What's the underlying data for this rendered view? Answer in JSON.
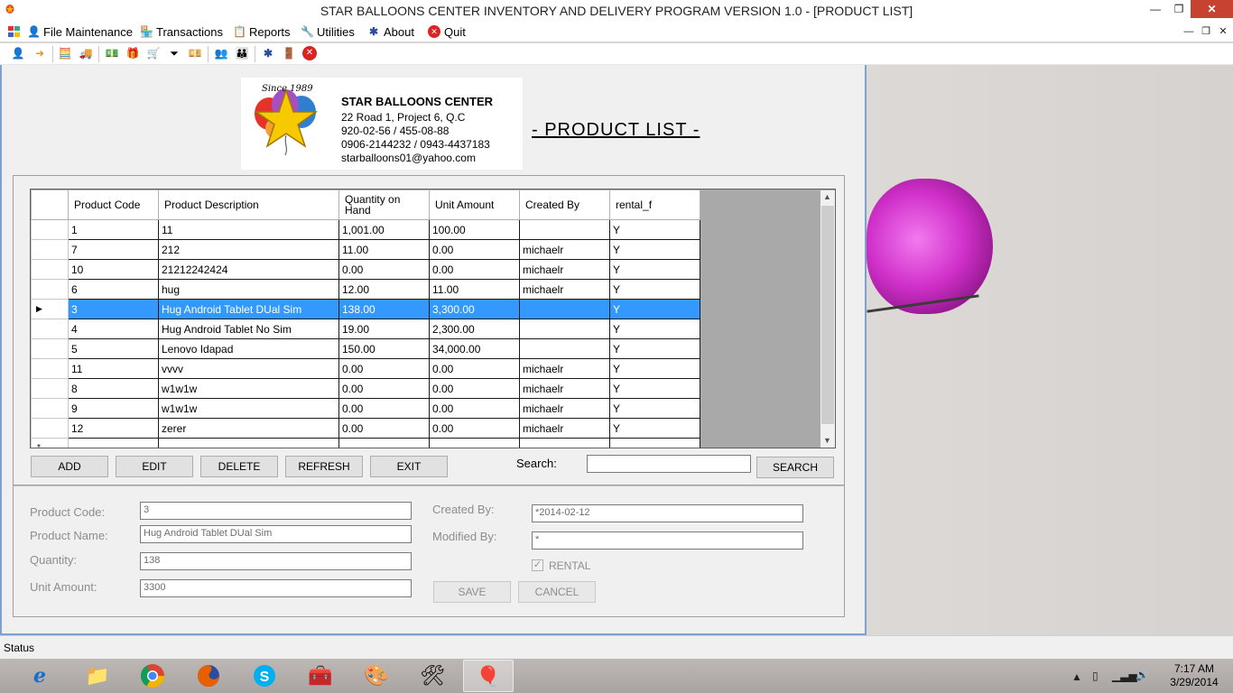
{
  "window": {
    "title": "STAR BALLOONS CENTER INVENTORY AND DELIVERY PROGRAM VERSION 1.0 - [PRODUCT LIST]",
    "app_icon": "balloon-icon",
    "minimize": "—",
    "maximize": "❐",
    "close": "✕"
  },
  "menu": {
    "items": [
      {
        "label": "File Maintenance",
        "icon": "person-icon"
      },
      {
        "label": "Transactions",
        "icon": "store-icon"
      },
      {
        "label": "Reports",
        "icon": "report-icon"
      },
      {
        "label": "Utilities",
        "icon": "wrench-icon"
      },
      {
        "label": "About",
        "icon": "about-icon"
      },
      {
        "label": "Quit",
        "icon": "quit-icon"
      }
    ],
    "mdi_min": "—",
    "mdi_restore": "❐",
    "mdi_close": "✕"
  },
  "toolbar": {
    "icons": [
      "user-icon",
      "arrow-icon",
      "calculator-icon",
      "truck-icon",
      "money-icon",
      "gift-icon",
      "filter-icon",
      "cart-icon",
      "cash-icon",
      "people-icon",
      "group-icon",
      "info-icon",
      "exit-door-icon",
      "close-circle-icon"
    ]
  },
  "logo": {
    "since": "Since 1989",
    "company": "STAR BALLOONS CENTER",
    "address_lines": [
      "22 Road 1, Project 6, Q.C",
      "920-02-56 / 455-08-88",
      "0906-2144232 / 0943-4437183",
      "starballoons01@yahoo.com"
    ]
  },
  "page_title": "- PRODUCT LIST -",
  "grid": {
    "columns": [
      "Product Code",
      "Product Description",
      "Quantity on Hand",
      "Unit Amount",
      "Created By",
      "rental_f"
    ],
    "rows": [
      [
        "1",
        "11",
        "1,001.00",
        "100.00",
        "",
        "Y"
      ],
      [
        "7",
        "212",
        "11.00",
        "0.00",
        "michaelr",
        "Y"
      ],
      [
        "10",
        "21212242424",
        "0.00",
        "0.00",
        "michaelr",
        "Y"
      ],
      [
        "6",
        "hug",
        "12.00",
        "11.00",
        "michaelr",
        "Y"
      ],
      [
        "3",
        "Hug Android Tablet DUal Sim",
        "138.00",
        "3,300.00",
        "",
        "Y"
      ],
      [
        "4",
        "Hug Android Tablet No Sim",
        "19.00",
        "2,300.00",
        "",
        "Y"
      ],
      [
        "5",
        "Lenovo Idapad",
        "150.00",
        "34,000.00",
        "",
        "Y"
      ],
      [
        "11",
        "vvvv",
        "0.00",
        "0.00",
        "michaelr",
        "Y"
      ],
      [
        "8",
        "w1w1w",
        "0.00",
        "0.00",
        "michaelr",
        "Y"
      ],
      [
        "9",
        "w1w1w",
        "0.00",
        "0.00",
        "michaelr",
        "Y"
      ],
      [
        "12",
        "zerer",
        "0.00",
        "0.00",
        "michaelr",
        "Y"
      ]
    ],
    "selected_row_index": 4,
    "selected_marker": "▶",
    "new_row_marker": "*"
  },
  "buttons": {
    "add": "ADD",
    "edit": "EDIT",
    "delete": "DELETE",
    "refresh": "REFRESH",
    "exit": "EXIT",
    "search": "SEARCH",
    "save": "SAVE",
    "cancel": "CANCEL"
  },
  "search": {
    "label": "Search:",
    "value": ""
  },
  "details": {
    "product_code_label": "Product Code:",
    "product_code_value": "3",
    "product_name_label": "Product Name:",
    "product_name_value": "Hug Android Tablet DUal Sim",
    "quantity_label": "Quantity:",
    "quantity_value": "138",
    "unit_amount_label": "Unit Amount:",
    "unit_amount_value": "3300",
    "created_by_label": "Created By:",
    "created_by_value": "*2014-02-12",
    "modified_by_label": "Modified By:",
    "modified_by_value": "*",
    "rental_label": "RENTAL",
    "rental_checked": true
  },
  "status": {
    "text": "Status"
  },
  "taskbar": {
    "apps": [
      "ie-icon",
      "explorer-icon",
      "chrome-icon",
      "firefox-icon",
      "skype-icon",
      "app-icon",
      "paint-icon",
      "tools-icon",
      "balloon-app-icon"
    ],
    "time": "7:17 AM",
    "date": "3/29/2014"
  },
  "colors": {
    "selection": "#3399ff",
    "accent_border": "#7f9fcf",
    "close_red": "#c7432f"
  }
}
